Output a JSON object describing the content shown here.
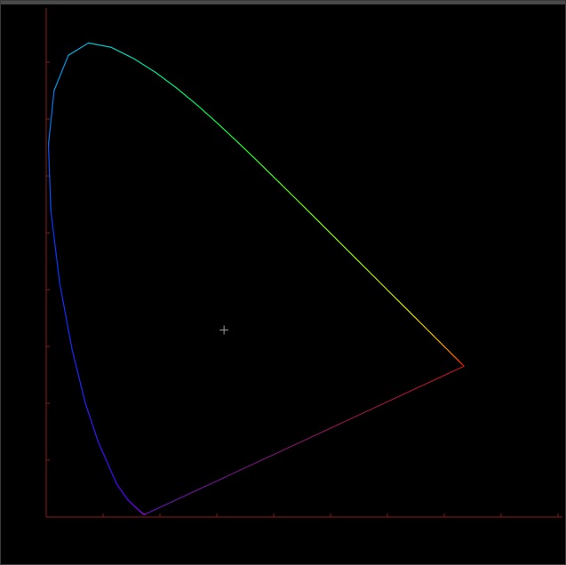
{
  "window": {
    "title": ""
  },
  "colors": {
    "background": "#000000",
    "titlebar": "#4a4a4a",
    "axis": "#8b1a1a",
    "crosshair": "#a0a0a0"
  },
  "chart_data": {
    "type": "line",
    "title": "",
    "xlabel": "",
    "ylabel": "",
    "xlim": [
      0,
      0.9
    ],
    "ylim": [
      0,
      0.9
    ],
    "x_ticks": [
      0.1,
      0.2,
      0.3,
      0.4,
      0.5,
      0.6,
      0.7,
      0.8,
      0.9
    ],
    "y_ticks": [
      0.1,
      0.2,
      0.3,
      0.4,
      0.5,
      0.6,
      0.7,
      0.8
    ],
    "series": [
      {
        "kind": "spectral-locus",
        "x": [
          0.1741,
          0.1738,
          0.173,
          0.1714,
          0.1689,
          0.1644,
          0.1566,
          0.144,
          0.1241,
          0.0913,
          0.0687,
          0.0454,
          0.0235,
          0.0082,
          0.0039,
          0.0139,
          0.0389,
          0.0743,
          0.1142,
          0.1547,
          0.1929,
          0.2296,
          0.2658,
          0.3016,
          0.3373,
          0.3731,
          0.4087,
          0.4441,
          0.4788,
          0.5125,
          0.5448,
          0.5752,
          0.6029,
          0.627,
          0.6482,
          0.6658,
          0.6801,
          0.6915,
          0.7006,
          0.7079,
          0.714,
          0.719,
          0.723,
          0.726,
          0.7283,
          0.73,
          0.7311,
          0.732,
          0.7327,
          0.7334,
          0.734,
          0.7347
        ],
        "y": [
          0.005,
          0.0049,
          0.0048,
          0.0048,
          0.0069,
          0.0109,
          0.0177,
          0.0297,
          0.0578,
          0.1327,
          0.2007,
          0.295,
          0.4127,
          0.5384,
          0.6548,
          0.7502,
          0.812,
          0.8338,
          0.8262,
          0.8059,
          0.7816,
          0.7543,
          0.7243,
          0.6923,
          0.6589,
          0.6245,
          0.5896,
          0.5547,
          0.5202,
          0.4866,
          0.4544,
          0.4242,
          0.3965,
          0.3725,
          0.3514,
          0.334,
          0.3197,
          0.3083,
          0.2993,
          0.292,
          0.2859,
          0.2809,
          0.277,
          0.274,
          0.2717,
          0.27,
          0.2689,
          0.268,
          0.2673,
          0.2666,
          0.266,
          0.2653
        ]
      }
    ],
    "markers": [
      {
        "kind": "white-point-crosshair",
        "x": 0.3127,
        "y": 0.329
      }
    ]
  }
}
